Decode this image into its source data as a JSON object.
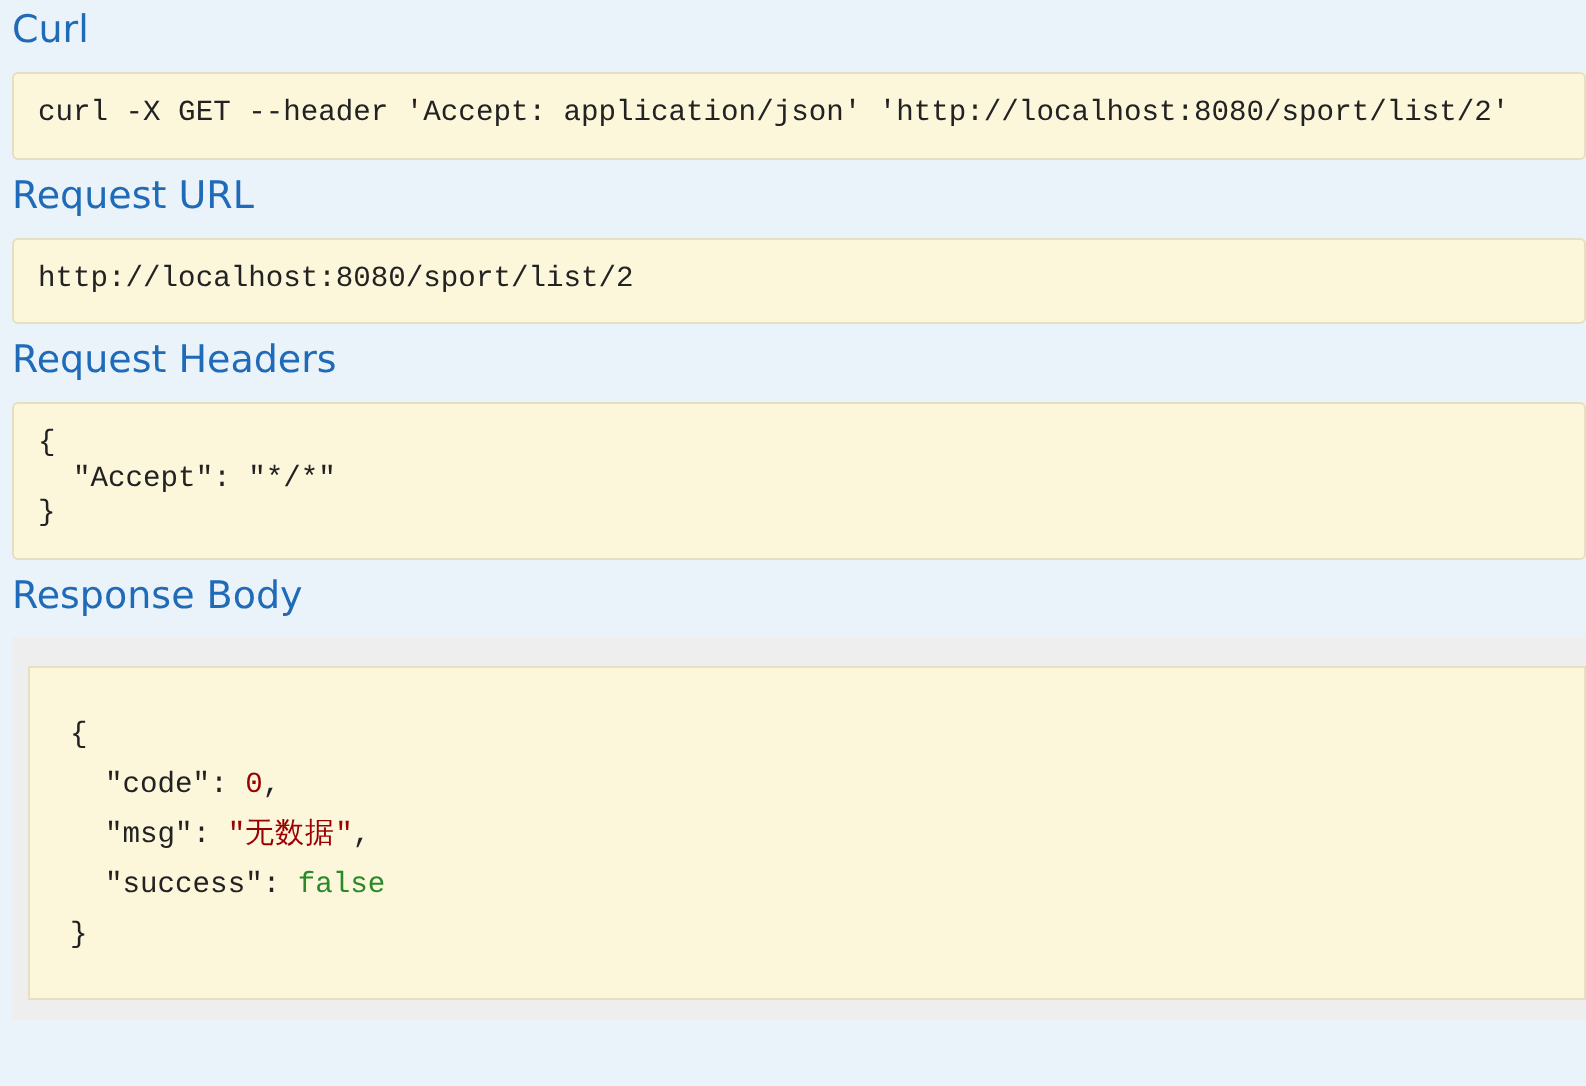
{
  "sections": [
    {
      "title": "Curl",
      "kind": "plain",
      "text": "curl -X GET --header 'Accept: application/json' 'http://localhost:8080/sport/list/2'"
    },
    {
      "title": "Request URL",
      "kind": "plain",
      "text": "http://localhost:8080/sport/list/2"
    },
    {
      "title": "Request Headers",
      "kind": "plain",
      "text": "{\n  \"Accept\": \"*/*\"\n}"
    },
    {
      "title": "Response Body",
      "kind": "highlighted",
      "lines": [
        [
          {
            "kind": "punct",
            "text": "{"
          }
        ],
        [
          {
            "kind": "key",
            "text": "  \"code\""
          },
          {
            "kind": "punct",
            "text": ": "
          },
          {
            "kind": "number",
            "text": "0"
          },
          {
            "kind": "punct",
            "text": ","
          }
        ],
        [
          {
            "kind": "key",
            "text": "  \"msg\""
          },
          {
            "kind": "punct",
            "text": ": "
          },
          {
            "kind": "string",
            "text": "\"无数据\""
          },
          {
            "kind": "punct",
            "text": ","
          }
        ],
        [
          {
            "kind": "key",
            "text": "  \"success\""
          },
          {
            "kind": "punct",
            "text": ": "
          },
          {
            "kind": "boolean",
            "text": "false"
          }
        ],
        [
          {
            "kind": "punct",
            "text": "}"
          }
        ]
      ]
    }
  ]
}
